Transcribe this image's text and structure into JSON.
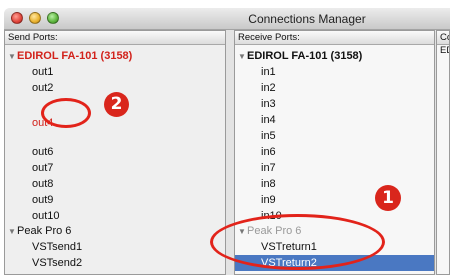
{
  "window": {
    "title": "Connections Manager"
  },
  "send": {
    "header": "Send Ports:",
    "devices": [
      {
        "name": "EDIROL FA-101 (3158)",
        "ports": [
          "out1",
          "out2",
          "out4",
          "out6",
          "out7",
          "out8",
          "out9",
          "out10"
        ]
      },
      {
        "name": "Peak Pro 6",
        "ports": [
          "VSTsend1",
          "VSTsend2"
        ]
      }
    ]
  },
  "receive": {
    "header": "Receive Ports:",
    "devices": [
      {
        "name": "EDIROL FA-101 (3158)",
        "ports": [
          "in1",
          "in2",
          "in3",
          "in4",
          "in5",
          "in6",
          "in7",
          "in8",
          "in9",
          "in10"
        ]
      },
      {
        "name": "Peak Pro 6",
        "ports": [
          "VSTreturn1",
          "VSTreturn2"
        ]
      }
    ]
  },
  "connections": {
    "header": "Co",
    "sub": "ED"
  },
  "annotations": {
    "badge_1": "1",
    "badge_2": "2"
  },
  "colors": {
    "highlight": "#4a78c2",
    "annotation_red": "#e2231a"
  }
}
